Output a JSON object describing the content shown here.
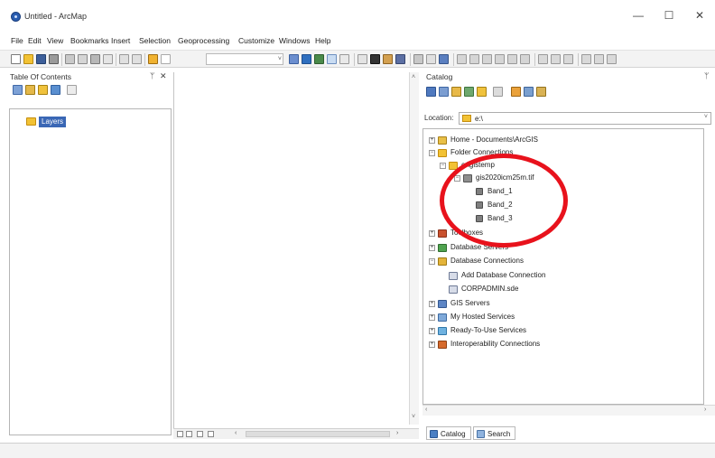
{
  "window": {
    "title": "Untitled - ArcMap",
    "minimize": "—",
    "maximize": "☐",
    "close": "✕"
  },
  "menu": [
    "File",
    "Edit",
    "View",
    "Bookmarks",
    "Insert",
    "Selection",
    "Geoprocessing",
    "Customize",
    "Windows",
    "Help"
  ],
  "toc": {
    "title": "Table Of Contents",
    "pin": "ᛘ",
    "close": "✕",
    "root_label": "Layers"
  },
  "catalog": {
    "title": "Catalog",
    "pin": "ᛘ",
    "close": "✕",
    "location_label": "Location:",
    "location_value": "e:\\",
    "tree": {
      "home": "Home - Documents\\ArcGIS",
      "folder_connections": "Folder Connections",
      "gistemp": "e:\\gistemp",
      "raster": "gis2020icm25m.tif",
      "band_1": "Band_1",
      "band_2": "Band_2",
      "band_3": "Band_3",
      "toolboxes": "Toolboxes",
      "database_servers": "Database Servers",
      "database_connections": "Database Connections",
      "add_database_connection": "Add Database Connection",
      "corpadmin": "CORPADMIN.sde",
      "gis_servers": "GIS Servers",
      "hosted_services": "My Hosted Services",
      "ready_to_use": "Ready-To-Use Services",
      "interoperability": "Interoperability Connections"
    },
    "tabs": {
      "catalog": "Catalog",
      "search": "Search"
    }
  },
  "symbols": {
    "plus": "+",
    "minus": "−",
    "arrow_left": "‹",
    "arrow_right": "›",
    "arrow_up": "˄",
    "arrow_down": "˅"
  },
  "colors": {
    "accent_blue": "#3a67b5",
    "highlight_red": "#e8121c",
    "folder_yellow": "#f2c234"
  }
}
